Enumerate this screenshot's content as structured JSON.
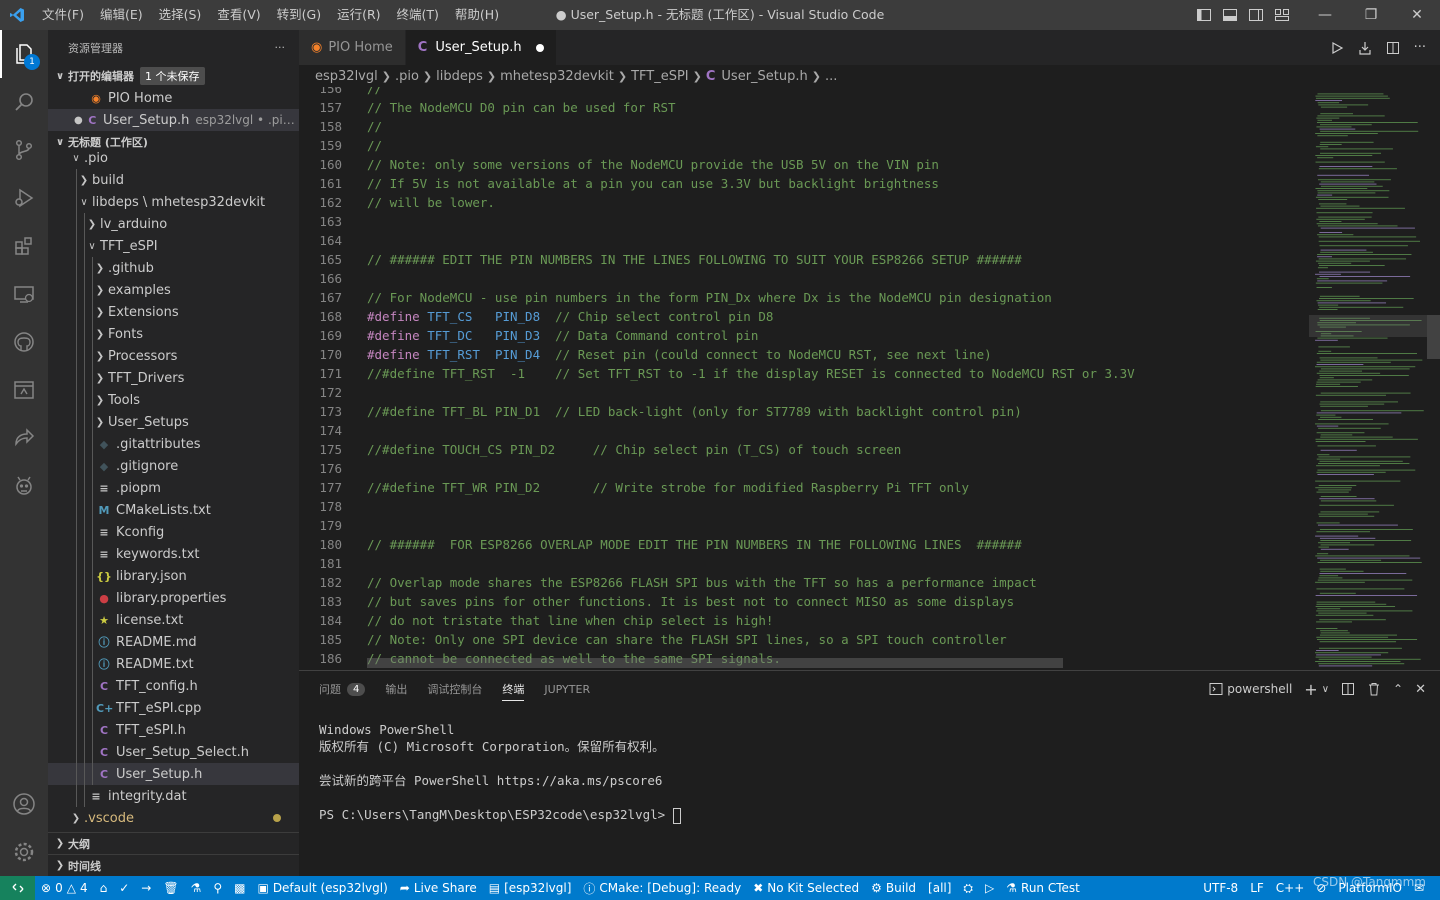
{
  "titlebar": {
    "menu": [
      "文件(F)",
      "编辑(E)",
      "选择(S)",
      "查看(V)",
      "转到(G)",
      "运行(R)",
      "终端(T)",
      "帮助(H)"
    ],
    "title": "● User_Setup.h - 无标题 (工作区) - Visual Studio Code"
  },
  "activity": {
    "explorer_badge": "1"
  },
  "sidebar": {
    "title": "资源管理器",
    "more": "···",
    "open_editors": {
      "label": "打开的编辑器",
      "unsaved": "1 个未保存"
    },
    "open_files": [
      {
        "name": "PIO Home",
        "desc": ""
      },
      {
        "name": "User_Setup.h",
        "desc": "esp32lvgl • .pio\\lib..."
      }
    ],
    "workspace": "无标题 (工作区)",
    "tree": [
      {
        "name": ".pio",
        "type": "folder-open",
        "depth": 1
      },
      {
        "name": "build",
        "type": "folder",
        "depth": 2
      },
      {
        "name": "libdeps \\ mhetesp32devkit",
        "type": "folder-open",
        "depth": 2
      },
      {
        "name": "lv_arduino",
        "type": "folder",
        "depth": 3
      },
      {
        "name": "TFT_eSPI",
        "type": "folder-open",
        "depth": 3
      },
      {
        "name": ".github",
        "type": "folder",
        "depth": 4
      },
      {
        "name": "examples",
        "type": "folder",
        "depth": 4
      },
      {
        "name": "Extensions",
        "type": "folder",
        "depth": 4
      },
      {
        "name": "Fonts",
        "type": "folder",
        "depth": 4
      },
      {
        "name": "Processors",
        "type": "folder",
        "depth": 4
      },
      {
        "name": "TFT_Drivers",
        "type": "folder",
        "depth": 4
      },
      {
        "name": "Tools",
        "type": "folder",
        "depth": 4
      },
      {
        "name": "User_Setups",
        "type": "folder",
        "depth": 4
      },
      {
        "name": ".gitattributes",
        "type": "git",
        "depth": 4
      },
      {
        "name": ".gitignore",
        "type": "git",
        "depth": 4
      },
      {
        "name": ".piopm",
        "type": "lines",
        "depth": 4
      },
      {
        "name": "CMakeLists.txt",
        "type": "cmake",
        "depth": 4
      },
      {
        "name": "Kconfig",
        "type": "lines",
        "depth": 4
      },
      {
        "name": "keywords.txt",
        "type": "lines",
        "depth": 4
      },
      {
        "name": "library.json",
        "type": "json",
        "depth": 4
      },
      {
        "name": "library.properties",
        "type": "props",
        "depth": 4
      },
      {
        "name": "license.txt",
        "type": "license",
        "depth": 4
      },
      {
        "name": "README.md",
        "type": "info",
        "depth": 4
      },
      {
        "name": "README.txt",
        "type": "info",
        "depth": 4
      },
      {
        "name": "TFT_config.h",
        "type": "c",
        "depth": 4
      },
      {
        "name": "TFT_eSPI.cpp",
        "type": "cpp",
        "depth": 4
      },
      {
        "name": "TFT_eSPI.h",
        "type": "c",
        "depth": 4
      },
      {
        "name": "User_Setup_Select.h",
        "type": "c",
        "depth": 4
      },
      {
        "name": "User_Setup.h",
        "type": "c",
        "depth": 4,
        "selected": true
      },
      {
        "name": "integrity.dat",
        "type": "lines",
        "depth": 3
      },
      {
        "name": ".vscode",
        "type": "folder",
        "depth": 1,
        "modified": true
      }
    ],
    "outline": "大纲",
    "timeline": "时间线"
  },
  "tabs": [
    {
      "label": "PIO Home",
      "active": false
    },
    {
      "label": "User_Setup.h",
      "active": true,
      "modified": true
    }
  ],
  "breadcrumbs": [
    "esp32lvgl",
    ".pio",
    "libdeps",
    "mhetesp32devkit",
    "TFT_eSPI",
    "User_Setup.h",
    "..."
  ],
  "code": [
    {
      "n": "156",
      "t": "//",
      "k": "comment"
    },
    {
      "n": "157",
      "t": "// The NodeMCU D0 pin can be used for RST",
      "k": "comment"
    },
    {
      "n": "158",
      "t": "//",
      "k": "comment"
    },
    {
      "n": "159",
      "t": "//",
      "k": "comment"
    },
    {
      "n": "160",
      "t": "// Note: only some versions of the NodeMCU provide the USB 5V on the VIN pin",
      "k": "comment"
    },
    {
      "n": "161",
      "t": "// If 5V is not available at a pin you can use 3.3V but backlight brightness",
      "k": "comment"
    },
    {
      "n": "162",
      "t": "// will be lower.",
      "k": "comment"
    },
    {
      "n": "163",
      "t": "",
      "k": "comment"
    },
    {
      "n": "164",
      "t": "",
      "k": "comment"
    },
    {
      "n": "165",
      "t": "// ###### EDIT THE PIN NUMBERS IN THE LINES FOLLOWING TO SUIT YOUR ESP8266 SETUP ######",
      "k": "comment"
    },
    {
      "n": "166",
      "t": "",
      "k": "comment"
    },
    {
      "n": "167",
      "t": "// For NodeMCU - use pin numbers in the form PIN_Dx where Dx is the NodeMCU pin designation",
      "k": "comment"
    },
    {
      "n": "168",
      "t": "",
      "k": "define",
      "d": "#define",
      "m": "TFT_CS   PIN_D8",
      "c": "  // Chip select control pin D8"
    },
    {
      "n": "169",
      "t": "",
      "k": "define",
      "d": "#define",
      "m": "TFT_DC   PIN_D3",
      "c": "  // Data Command control pin"
    },
    {
      "n": "170",
      "t": "",
      "k": "define",
      "d": "#define",
      "m": "TFT_RST  PIN_D4",
      "c": "  // Reset pin (could connect to NodeMCU RST, see next line)"
    },
    {
      "n": "171",
      "t": "//#define TFT_RST  -1    // Set TFT_RST to -1 if the display RESET is connected to NodeMCU RST or 3.3V",
      "k": "comment"
    },
    {
      "n": "172",
      "t": "",
      "k": "comment"
    },
    {
      "n": "173",
      "t": "//#define TFT_BL PIN_D1  // LED back-light (only for ST7789 with backlight control pin)",
      "k": "comment"
    },
    {
      "n": "174",
      "t": "",
      "k": "comment"
    },
    {
      "n": "175",
      "t": "//#define TOUCH_CS PIN_D2     // Chip select pin (T_CS) of touch screen",
      "k": "comment"
    },
    {
      "n": "176",
      "t": "",
      "k": "comment"
    },
    {
      "n": "177",
      "t": "//#define TFT_WR PIN_D2       // Write strobe for modified Raspberry Pi TFT only",
      "k": "comment"
    },
    {
      "n": "178",
      "t": "",
      "k": "comment"
    },
    {
      "n": "179",
      "t": "",
      "k": "comment"
    },
    {
      "n": "180",
      "t": "// ######  FOR ESP8266 OVERLAP MODE EDIT THE PIN NUMBERS IN THE FOLLOWING LINES  ######",
      "k": "comment"
    },
    {
      "n": "181",
      "t": "",
      "k": "comment"
    },
    {
      "n": "182",
      "t": "// Overlap mode shares the ESP8266 FLASH SPI bus with the TFT so has a performance impact",
      "k": "comment"
    },
    {
      "n": "183",
      "t": "// but saves pins for other functions. It is best not to connect MISO as some displays",
      "k": "comment"
    },
    {
      "n": "184",
      "t": "// do not tristate that line when chip select is high!",
      "k": "comment"
    },
    {
      "n": "185",
      "t": "// Note: Only one SPI device can share the FLASH SPI lines, so a SPI touch controller",
      "k": "comment"
    },
    {
      "n": "186",
      "t": "// cannot be connected as well to the same SPI signals.",
      "k": "comment"
    }
  ],
  "panel": {
    "tabs": [
      {
        "label": "问题",
        "count": "4"
      },
      {
        "label": "输出"
      },
      {
        "label": "调试控制台"
      },
      {
        "label": "终端",
        "active": true
      },
      {
        "label": "JUPYTER"
      }
    ],
    "terminal_name": "powershell",
    "terminal_lines": [
      "Windows PowerShell",
      "版权所有 (C) Microsoft Corporation。保留所有权利。",
      "",
      "尝试新的跨平台 PowerShell https://aka.ms/pscore6",
      "",
      "PS C:\\Users\\TangM\\Desktop\\ESP32code\\esp32lvgl> "
    ]
  },
  "statusbar": {
    "errors": "0",
    "warnings": "4",
    "env": "Default (esp32lvgl)",
    "live_share": "Live Share",
    "project": "[esp32lvgl]",
    "cmake": "CMake: [Debug]: Ready",
    "kit": "No Kit Selected",
    "build": "Build",
    "all": "[all]",
    "run_ctest": "Run CTest",
    "encoding": "UTF-8",
    "eol": "LF",
    "language": "C++",
    "platform": "PlatformIO",
    "watermark": "CSDN @Tangmmm"
  },
  "colors": {
    "accent": "#007acc",
    "remote": "#16825d",
    "comment": "#6a9955",
    "preproc": "#c586c0",
    "macro": "#569cd6"
  }
}
